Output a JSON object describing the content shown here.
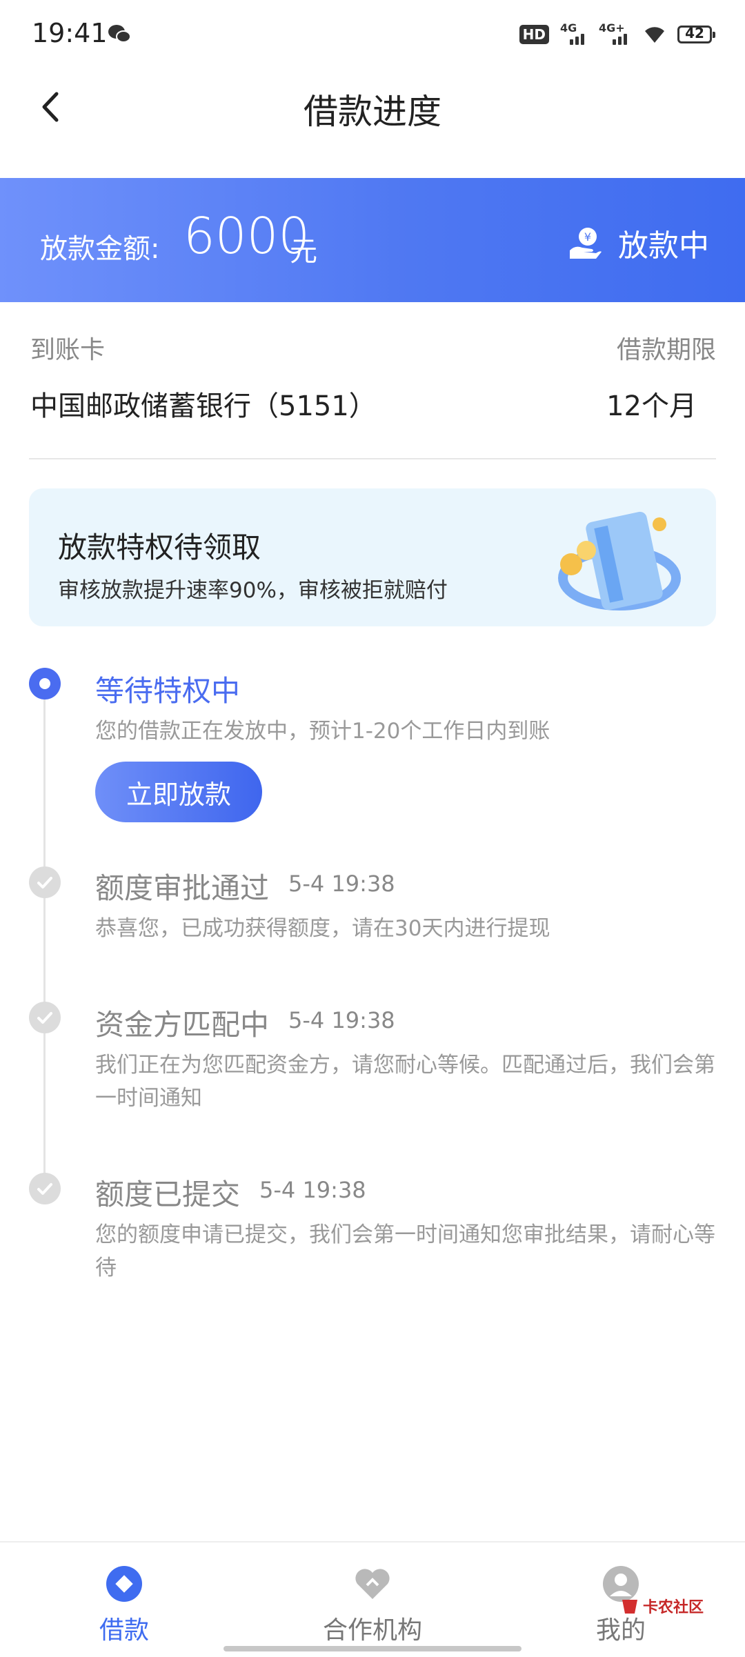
{
  "status_bar": {
    "time": "19:41",
    "hd_label": "HD",
    "net1_label": "4G",
    "net2_label": "4G+",
    "battery": "42"
  },
  "nav": {
    "title": "借款进度"
  },
  "hero": {
    "label": "放款金额:",
    "amount": "6000",
    "unit": "元",
    "status": "放款中"
  },
  "info": {
    "card_label": "到账卡",
    "card_value": "中国邮政储蓄银行（5151）",
    "term_label": "借款期限",
    "term_value": "12个月"
  },
  "privilege": {
    "title": "放款特权待领取",
    "desc": "审核放款提升速率90%，审核被拒就赔付"
  },
  "steps": [
    {
      "title": "等待特权中",
      "time": "",
      "desc": "您的借款正在发放中，预计1-20个工作日内到账",
      "button": "立即放款"
    },
    {
      "title": "额度审批通过",
      "time": "5-4 19:38",
      "desc": "恭喜您，已成功获得额度，请在30天内进行提现"
    },
    {
      "title": "资金方匹配中",
      "time": "5-4 19:38",
      "desc": "我们正在为您匹配资金方，请您耐心等候。匹配通过后，我们会第一时间通知"
    },
    {
      "title": "额度已提交",
      "time": "5-4 19:38",
      "desc": "您的额度申请已提交，我们会第一时间通知您审批结果，请耐心等待"
    }
  ],
  "tabs": [
    {
      "label": "借款",
      "icon": "loan-icon"
    },
    {
      "label": "合作机构",
      "icon": "partner-icon"
    },
    {
      "label": "我的",
      "icon": "profile-icon"
    }
  ],
  "watermark": {
    "text": "卡农社区"
  },
  "colors": {
    "accent": "#4a6cf0",
    "hero_start": "#6f91fb",
    "hero_end": "#3f6cf0"
  }
}
